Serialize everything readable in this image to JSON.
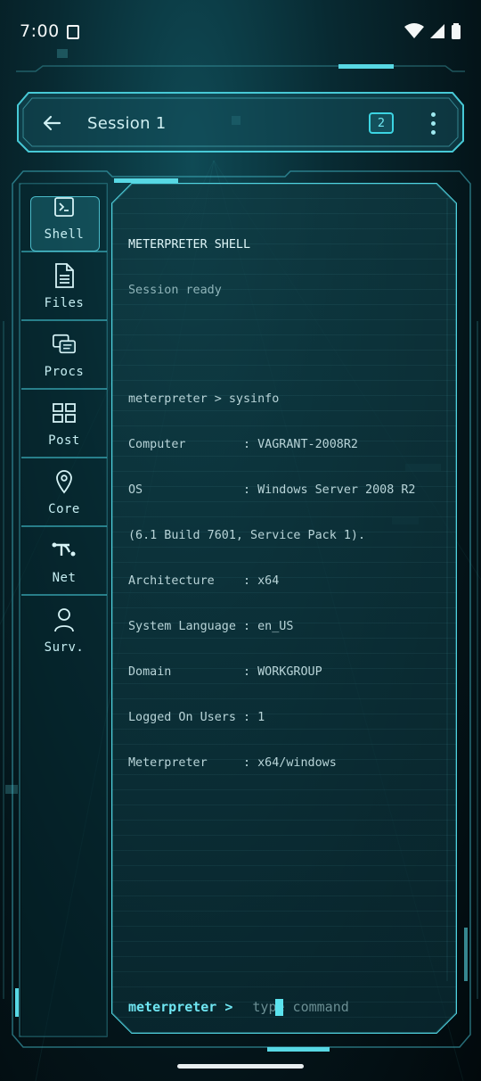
{
  "status_bar": {
    "time": "7:00"
  },
  "top_bar": {
    "title": "Session 1",
    "badge_count": "2"
  },
  "sidebar": {
    "items": [
      {
        "label": "Shell",
        "icon": "terminal-icon",
        "active": true
      },
      {
        "label": "Files",
        "icon": "file-icon",
        "active": false
      },
      {
        "label": "Procs",
        "icon": "processes-icon",
        "active": false
      },
      {
        "label": "Post",
        "icon": "grid-icon",
        "active": false
      },
      {
        "label": "Core",
        "icon": "location-pin-icon",
        "active": false
      },
      {
        "label": "Net",
        "icon": "network-icon",
        "active": false
      },
      {
        "label": "Surv.",
        "icon": "person-icon",
        "active": false
      }
    ]
  },
  "terminal": {
    "header": "METERPRETER SHELL",
    "subheader": "Session ready",
    "lines": [
      "meterpreter > sysinfo",
      "Computer        : VAGRANT-2008R2",
      "OS              : Windows Server 2008 R2",
      "(6.1 Build 7601, Service Pack 1).",
      "Architecture    : x64",
      "System Language : en_US",
      "Domain          : WORKGROUP",
      "Logged On Users : 1",
      "Meterpreter     : x64/windows"
    ],
    "prompt": "meterpreter >",
    "input_placeholder": "type command",
    "input_value": ""
  },
  "colors": {
    "accent": "#3cd4e2",
    "background": "#061c22",
    "panel": "#0f3a42"
  }
}
